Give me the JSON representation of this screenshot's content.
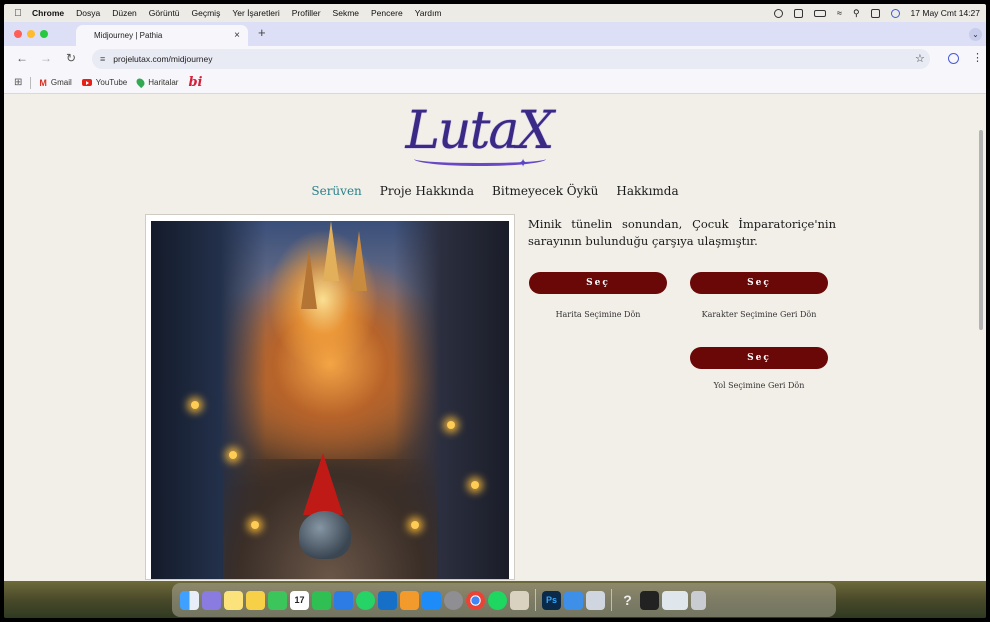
{
  "menubar": {
    "app": "Chrome",
    "items": [
      "Dosya",
      "Düzen",
      "Görüntü",
      "Geçmiş",
      "Yer İşaretleri",
      "Profiller",
      "Sekme",
      "Pencere",
      "Yardım"
    ],
    "clock": "17 May Cmt 14:27"
  },
  "browser": {
    "tab_title": "Midjourney | Pathia",
    "url": "projelutax.com/midjourney",
    "bookmarks": [
      "Gmail",
      "YouTube",
      "Haritalar"
    ],
    "bookmark_bi": "bi"
  },
  "site": {
    "logo": "LutaX",
    "nav": [
      "Serüven",
      "Proje Hakkında",
      "Bitmeyecek Öykü",
      "Hakkımda"
    ],
    "story": "Minik tünelin sonundan, Çocuk İmparatoriçe'nin sarayının bulunduğu çarşıya ulaşmıştır.",
    "choices": [
      {
        "button": "Seç",
        "caption": "Harita Seçimine Dön"
      },
      {
        "button": "Seç",
        "caption": "Karakter Seçimine Geri Dön"
      },
      {
        "button": "Seç",
        "caption": "Yol Seçimine Geri Dön"
      }
    ]
  },
  "dock": {
    "calendar_day": "17",
    "photoshop": "Ps",
    "question": "?"
  },
  "colors": {
    "accent_nav": "#2a7f87",
    "button": "#6a0808",
    "logo": "#3a2a86"
  }
}
